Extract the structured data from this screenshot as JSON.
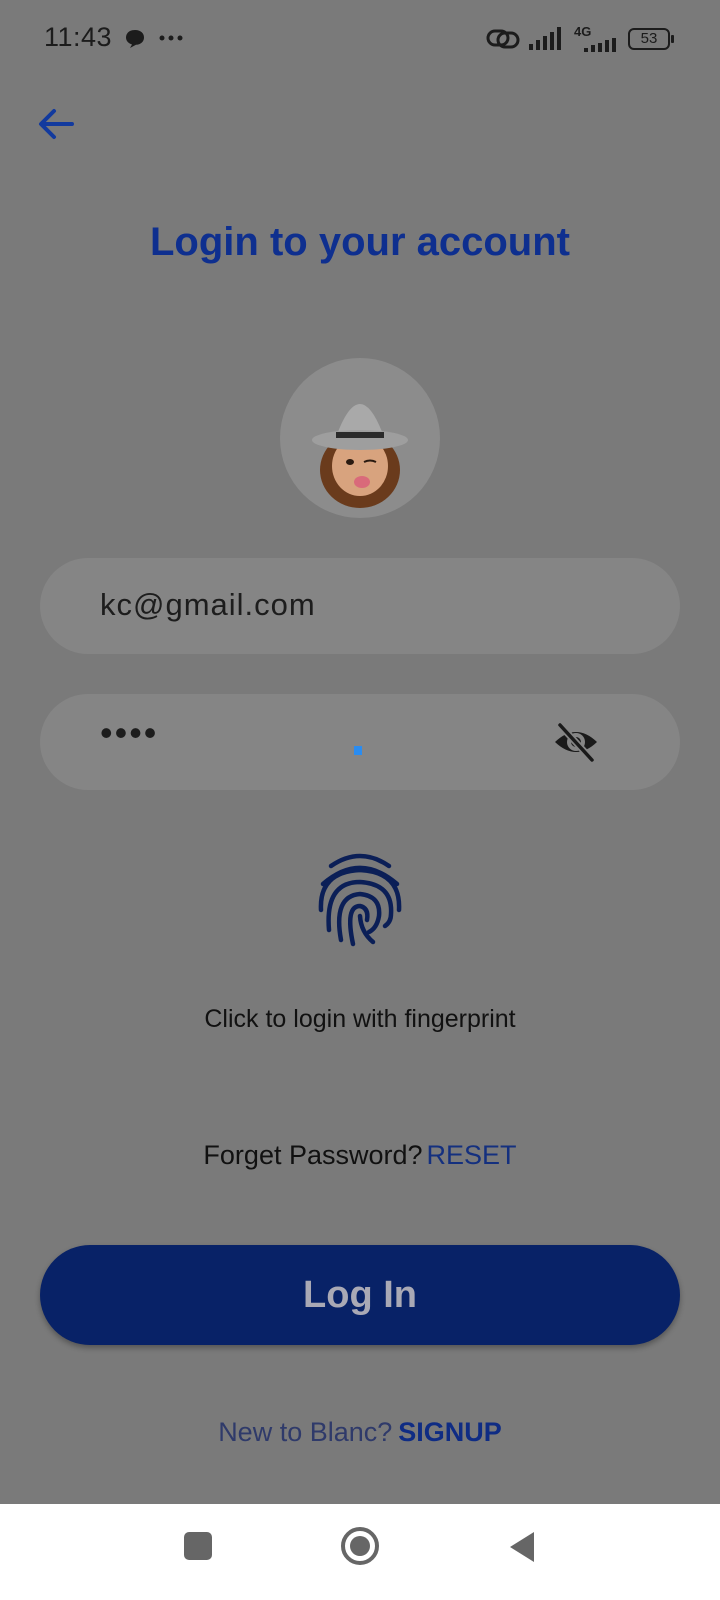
{
  "status_bar": {
    "time": "11:43",
    "battery": "53",
    "network": "4G"
  },
  "header": {
    "title": "Login to your account"
  },
  "form": {
    "email_value": "kc@gmail.com",
    "password_value": "••••"
  },
  "fingerprint": {
    "label": "Click to login with fingerprint"
  },
  "forgot": {
    "question": "Forget Password?",
    "reset_label": "RESET"
  },
  "login_button": {
    "label": "Log In"
  },
  "signup": {
    "question": "New to Blanc?",
    "link_label": "SIGNUP"
  },
  "colors": {
    "accent": "#0e2f8f",
    "overlay_bg": "#7a7a7a",
    "button_bg": "#082267"
  },
  "icons": [
    "back-arrow-icon",
    "chat-bubble-icon",
    "more-icon",
    "link-icon",
    "signal-icon",
    "battery-icon",
    "eye-off-icon",
    "fingerprint-icon",
    "recents-icon",
    "home-icon",
    "back-nav-icon"
  ]
}
